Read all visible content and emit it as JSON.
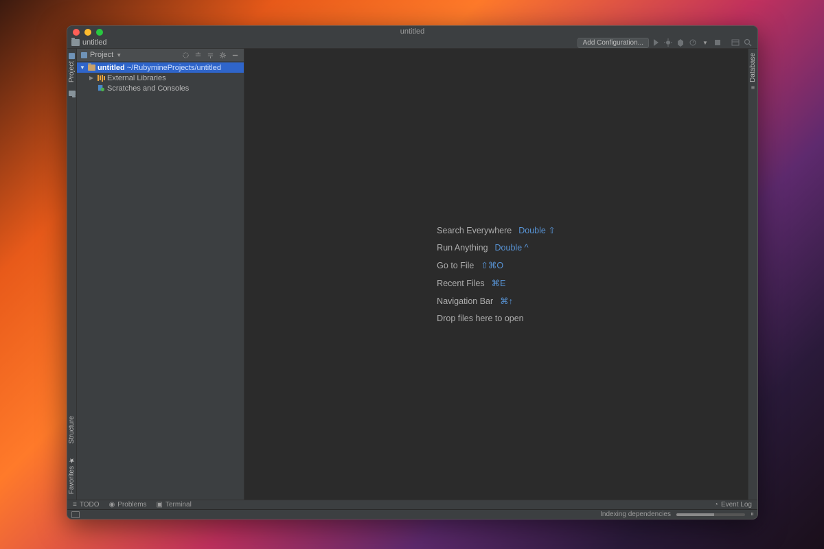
{
  "window": {
    "title": "untitled"
  },
  "toolbar": {
    "project_name": "untitled",
    "add_config": "Add Configuration..."
  },
  "left_gutter": {
    "project": "Project",
    "structure": "Structure",
    "favorites": "Favorites"
  },
  "right_gutter": {
    "database": "Database"
  },
  "project_panel": {
    "header": "Project",
    "root": {
      "name": "untitled",
      "path": "~/RubymineProjects/untitled"
    },
    "external_libs": "External Libraries",
    "scratches": "Scratches and Consoles"
  },
  "hints": {
    "search": {
      "label": "Search Everywhere",
      "shortcut": "Double ⇧"
    },
    "run": {
      "label": "Run Anything",
      "shortcut": "Double ^"
    },
    "gotofile": {
      "label": "Go to File",
      "shortcut": "⇧⌘O"
    },
    "recent": {
      "label": "Recent Files",
      "shortcut": "⌘E"
    },
    "navbar": {
      "label": "Navigation Bar",
      "shortcut": "⌘↑"
    },
    "drop": "Drop files here to open"
  },
  "bottom_bar": {
    "todo": "TODO",
    "problems": "Problems",
    "terminal": "Terminal",
    "event_log": "Event Log"
  },
  "status": {
    "indexing": "Indexing dependencies"
  }
}
